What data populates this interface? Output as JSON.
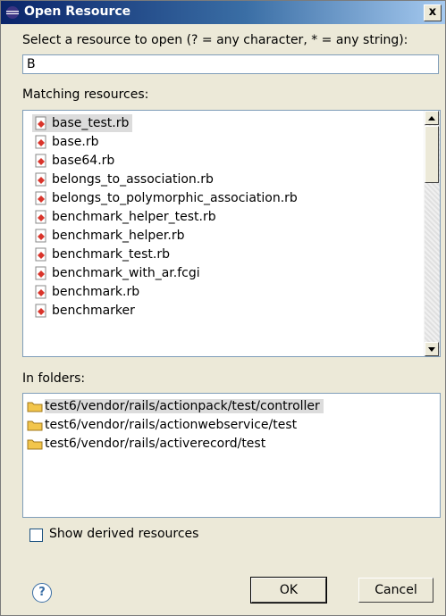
{
  "window": {
    "title": "Open Resource",
    "close_label": "x"
  },
  "prompt": "Select a resource to open (? = any character, * = any string):",
  "search": {
    "value": "B",
    "placeholder": ""
  },
  "matching_label": "Matching resources:",
  "matching_resources": [
    "base_test.rb",
    "base.rb",
    "base64.rb",
    "belongs_to_association.rb",
    "belongs_to_polymorphic_association.rb",
    "benchmark_helper_test.rb",
    "benchmark_helper.rb",
    "benchmark_test.rb",
    "benchmark_with_ar.fcgi",
    "benchmark.rb",
    "benchmarker"
  ],
  "folders_label": "In folders:",
  "folders": [
    "test6/vendor/rails/actionpack/test/controller",
    "test6/vendor/rails/actionwebservice/test",
    "test6/vendor/rails/activerecord/test"
  ],
  "show_derived_label": "Show derived resources",
  "buttons": {
    "ok": "OK",
    "cancel": "Cancel",
    "help": "?"
  },
  "colors": {
    "title_gradient_start": "#0a246a",
    "selection": "#dcdcdc",
    "file_icon": "#d9342b",
    "folder_icon": "#f2c54b"
  }
}
